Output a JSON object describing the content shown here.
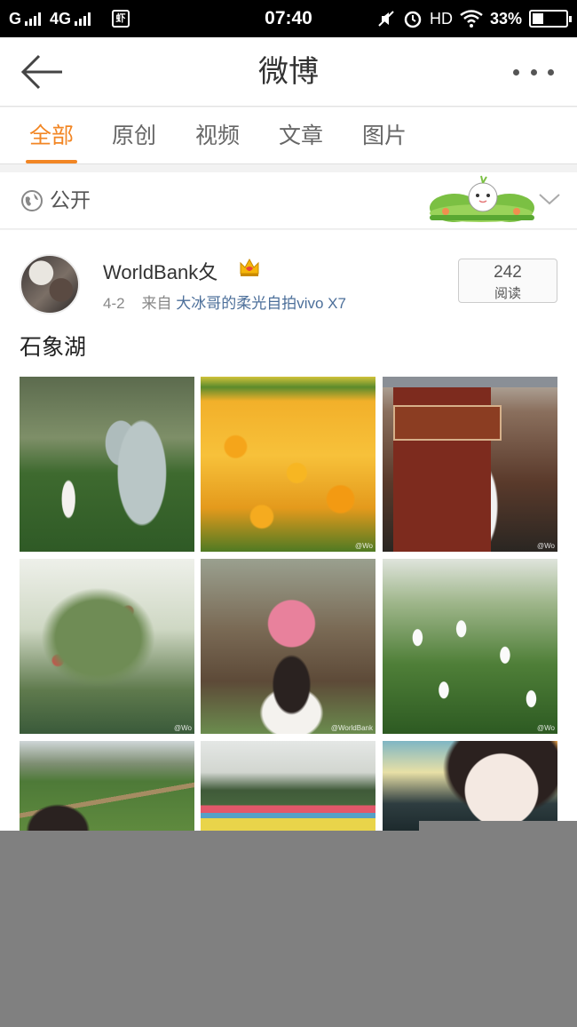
{
  "status_bar": {
    "carrier": "G",
    "network": "4G",
    "app_badge": "虾",
    "time": "07:40",
    "hd": "HD",
    "battery": "33%",
    "battery_level": 0.33,
    "icons": [
      "signal-icon",
      "mute-icon",
      "alarm-icon",
      "wifi-icon",
      "battery-icon"
    ]
  },
  "nav": {
    "title": "微博",
    "back_icon": "arrow-left-icon",
    "more_icon": "more-dots-icon"
  },
  "tabs": [
    {
      "label": "全部",
      "active": true
    },
    {
      "label": "原创",
      "active": false
    },
    {
      "label": "视频",
      "active": false
    },
    {
      "label": "文章",
      "active": false
    },
    {
      "label": "图片",
      "active": false
    }
  ],
  "visibility": {
    "label": "公开",
    "icon": "globe-icon",
    "chevron": "chevron-down-icon"
  },
  "post": {
    "author": "WorldBank夂",
    "badge_icon": "crown-icon",
    "date": "4-2",
    "source_prefix": "来自",
    "source": "大冰哥的柔光自拍vivo X7",
    "read_count": "242",
    "read_label": "阅读",
    "text": "石象湖",
    "photos": [
      {
        "name": "photo-elephant-statue",
        "watermark": ""
      },
      {
        "name": "photo-yellow-tulips",
        "watermark": "@Wo"
      },
      {
        "name": "photo-restaurant-door",
        "watermark": "@Wo"
      },
      {
        "name": "photo-blossom-tree",
        "watermark": "@Wo"
      },
      {
        "name": "photo-pink-flower-girl",
        "watermark": "@WorldBank"
      },
      {
        "name": "photo-white-tulips",
        "watermark": "@Wo"
      },
      {
        "name": "photo-green-hills",
        "watermark": ""
      },
      {
        "name": "photo-pinwheels",
        "watermark": ""
      },
      {
        "name": "photo-selfie-cat-ears",
        "watermark": ""
      }
    ]
  },
  "colors": {
    "accent": "#f28624",
    "link": "#4c6f9a",
    "overlay_gray": "#808080"
  }
}
